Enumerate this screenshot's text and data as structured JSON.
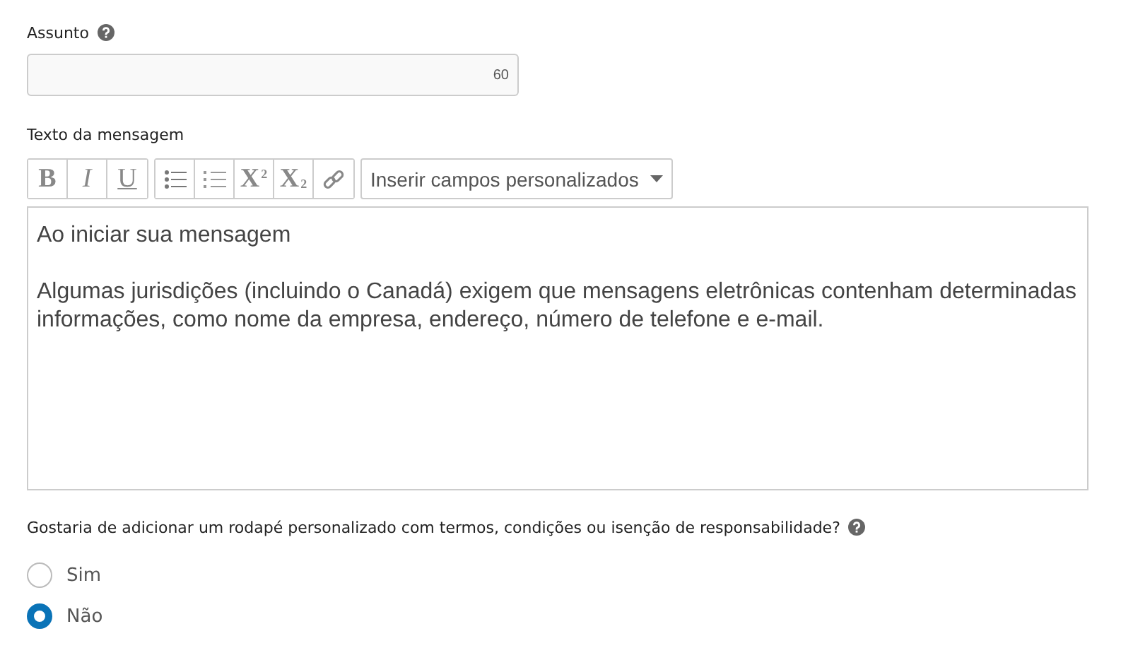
{
  "subject": {
    "label": "Assunto",
    "counter": "60"
  },
  "message": {
    "label": "Texto da mensagem",
    "toolbar": [
      [
        {
          "kind": "bold",
          "text": "B"
        },
        {
          "kind": "italic",
          "text": "I"
        },
        {
          "kind": "underline",
          "text": "U"
        }
      ],
      [
        {
          "kind": "bullets"
        },
        {
          "kind": "numbers"
        },
        {
          "kind": "sup",
          "text": "X",
          "small": "2"
        },
        {
          "kind": "sub",
          "text": "X",
          "small": "2"
        },
        {
          "kind": "link"
        }
      ]
    ],
    "fields_dropdown": "Inserir campos personalizados",
    "paragraphs": [
      "Ao iniciar sua mensagem",
      "Algumas jurisdições (incluindo o Canadá) exigem que mensagens eletrônicas contenham determinadas informações, como nome da empresa, endereço, número de telefone e e-mail."
    ]
  },
  "footer": {
    "question": "Gostaria de adicionar um rodapé personalizado com termos, condições ou isenção de responsabilidade?",
    "options": [
      {
        "label": "Sim",
        "selected": false
      },
      {
        "label": "Não",
        "selected": true
      }
    ]
  }
}
